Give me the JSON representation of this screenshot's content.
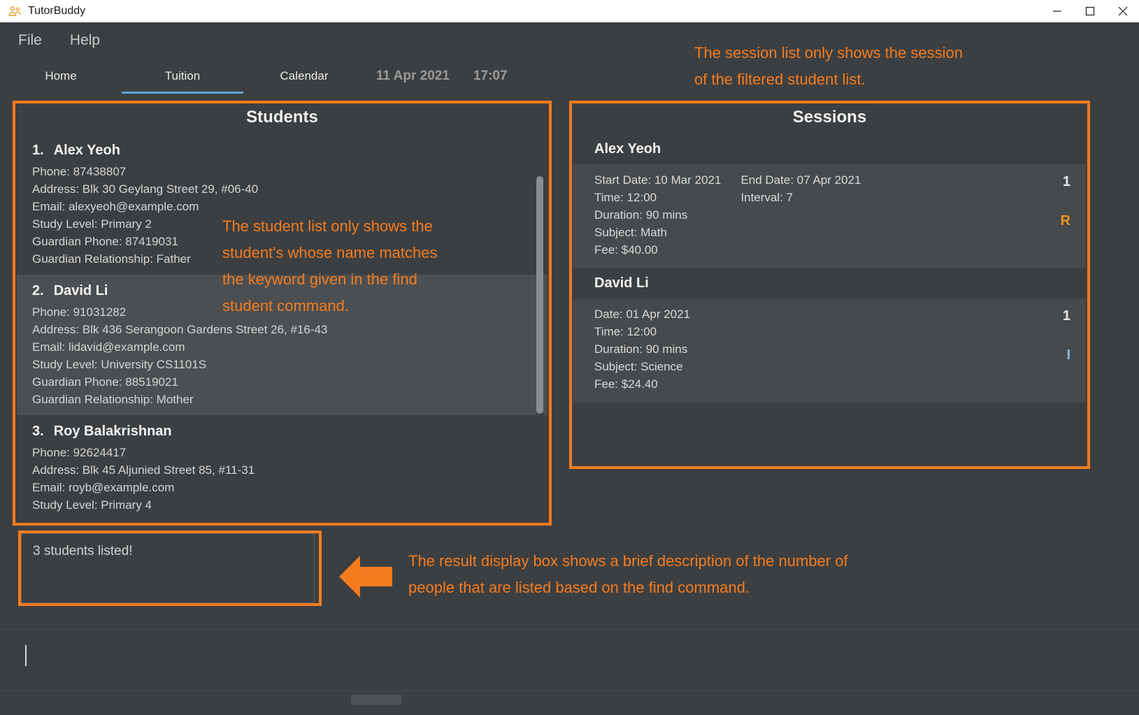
{
  "window": {
    "title": "TutorBuddy",
    "app_icon": "people-group-icon",
    "buttons": {
      "minimize": "minimize-icon",
      "maximize": "maximize-icon",
      "close": "close-icon"
    }
  },
  "menubar": {
    "items": [
      {
        "label": "File"
      },
      {
        "label": "Help"
      }
    ]
  },
  "tabs": [
    {
      "label": "Home",
      "active": false
    },
    {
      "label": "Tuition",
      "active": true
    },
    {
      "label": "Calendar",
      "active": false
    }
  ],
  "datetime": {
    "date": "11 Apr 2021",
    "time": "17:07"
  },
  "students_panel": {
    "title": "Students",
    "items": [
      {
        "index": "1.",
        "name": "Alex Yeoh",
        "phone": "Phone: 87438807",
        "address": "Address: Blk 30 Geylang Street 29, #06-40",
        "email": "Email: alexyeoh@example.com",
        "study_level": "Study Level: Primary 2",
        "guardian_phone": "Guardian Phone: 87419031",
        "guardian_relationship": "Guardian Relationship: Father"
      },
      {
        "index": "2.",
        "name": "David Li",
        "phone": "Phone: 91031282",
        "address": "Address: Blk 436 Serangoon Gardens Street 26, #16-43",
        "email": "Email: lidavid@example.com",
        "study_level": "Study Level: University CS1101S",
        "guardian_phone": "Guardian Phone: 88519021",
        "guardian_relationship": "Guardian Relationship: Mother"
      },
      {
        "index": "3.",
        "name": "Roy Balakrishnan",
        "phone": "Phone: 92624417",
        "address": "Address: Blk 45 Aljunied Street 85, #11-31",
        "email": "Email: royb@example.com",
        "study_level": "Study Level: Primary 4",
        "guardian_phone": "",
        "guardian_relationship": ""
      }
    ]
  },
  "sessions_panel": {
    "title": "Sessions",
    "items": [
      {
        "owner": "Alex Yeoh",
        "col1": [
          "Start Date: 10 Mar 2021",
          "Time: 12:00",
          "Duration: 90 mins",
          "Subject: Math",
          "Fee: $40.00"
        ],
        "col2": [
          "End Date: 07 Apr 2021",
          "Interval: 7"
        ],
        "count": "1",
        "flag": "R",
        "flag_kind": "recurring"
      },
      {
        "owner": "David Li",
        "col1": [
          "Date: 01 Apr 2021",
          "Time: 12:00",
          "Duration: 90 mins",
          "Subject: Science",
          "Fee: $24.40"
        ],
        "col2": [],
        "count": "1",
        "flag": "I",
        "flag_kind": "individual"
      }
    ]
  },
  "result_box": {
    "text": "3 students listed!"
  },
  "command_box": {
    "value": "",
    "placeholder": ""
  },
  "annotations": [
    {
      "id": "session-list-note",
      "text": "The session list only shows the session\nof the filtered student list."
    },
    {
      "id": "student-list-note",
      "text": "The student list only shows the\nstudent's whose name matches\nthe keyword given in the find\nstudent command."
    },
    {
      "id": "result-box-note",
      "text": "The result display box shows a brief description of the number of\npeople that are listed based on the find command."
    }
  ],
  "colors": {
    "annotation_orange": "#f57c1f",
    "window_bg": "#3c3f41",
    "card_alt": "#4b4f51",
    "tab_underline": "#5aa9d6",
    "flag_recurring": "#e8961e",
    "flag_individual": "#82bcd8",
    "titlebar_bg": "#ffffff",
    "app_icon_color": "#e8a63c"
  }
}
